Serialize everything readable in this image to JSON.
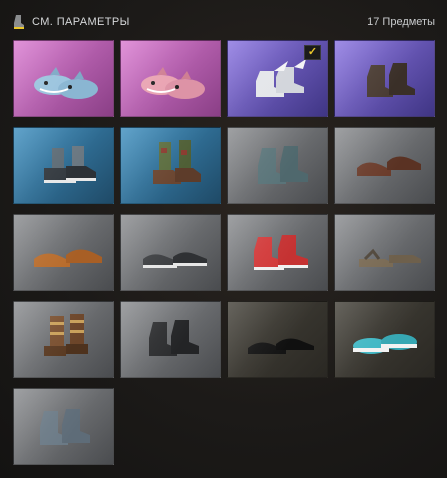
{
  "header": {
    "title": "СМ. ПАРАМЕТРЫ",
    "count": "17 Предметы",
    "icon": "boot-icon"
  },
  "colors": {
    "pink": "#c25fb8",
    "purple": "#6a58c0",
    "blue": "#2f6f96",
    "gray": "#6b6d70",
    "dark": "#3a372e",
    "check": "#e9c62b"
  },
  "items": [
    {
      "name": "shark-slippers-blue",
      "bg": "pink",
      "selected": false
    },
    {
      "name": "shark-slippers-pink",
      "bg": "pink",
      "selected": false
    },
    {
      "name": "winged-sneakers",
      "bg": "purple",
      "selected": true
    },
    {
      "name": "dark-leather-boots",
      "bg": "purple",
      "selected": false
    },
    {
      "name": "gray-sneakers-socks",
      "bg": "blue",
      "selected": false
    },
    {
      "name": "camo-high-boots",
      "bg": "blue",
      "selected": false
    },
    {
      "name": "teal-combat-boots",
      "bg": "gray",
      "selected": false
    },
    {
      "name": "brown-dress-shoes",
      "bg": "gray",
      "selected": false
    },
    {
      "name": "tan-oxford-shoes",
      "bg": "gray",
      "selected": false
    },
    {
      "name": "black-slip-ons",
      "bg": "gray",
      "selected": false
    },
    {
      "name": "red-high-tops",
      "bg": "gray",
      "selected": false
    },
    {
      "name": "sandals",
      "bg": "gray",
      "selected": false
    },
    {
      "name": "buckled-brown-boots",
      "bg": "gray",
      "selected": false
    },
    {
      "name": "black-work-boots",
      "bg": "gray",
      "selected": false
    },
    {
      "name": "black-loafers",
      "bg": "dark",
      "selected": false
    },
    {
      "name": "teal-clogs",
      "bg": "dark",
      "selected": false
    },
    {
      "name": "gray-worn-boots",
      "bg": "gray",
      "selected": false
    }
  ]
}
